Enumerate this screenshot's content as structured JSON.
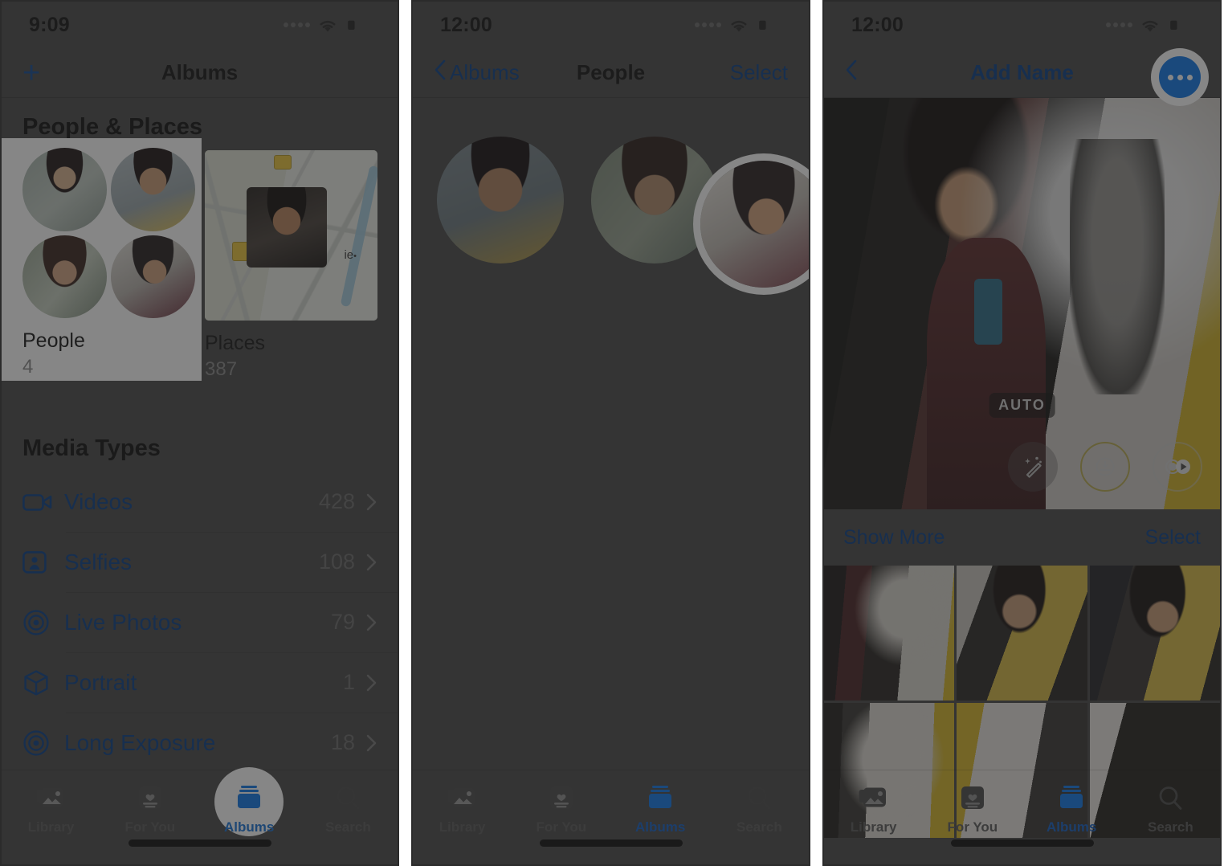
{
  "colors": {
    "ios_blue": "#0b3f86",
    "tab_active": "#1560c4",
    "dim_veil": "#232323",
    "highlight_white": "#ffffff",
    "panel_bg": "#4a4a4a"
  },
  "panels": [
    {
      "id": "albums-screen",
      "status": {
        "time": "9:09",
        "signal": "signal-dots-icon",
        "wifi": "wifi-icon",
        "battery": "battery-low-icon"
      },
      "nav": {
        "left_icon": "plus-icon",
        "title": "Albums",
        "right": ""
      },
      "sections": [
        {
          "heading": "People & Places",
          "cards": [
            {
              "label": "People",
              "count": "4",
              "thumb": "people-faces-grid",
              "highlighted": true
            },
            {
              "label": "Places",
              "count": "387",
              "thumb": "map-thumbnail",
              "highlighted": false
            }
          ]
        },
        {
          "heading": "Media Types",
          "rows": [
            {
              "icon": "video-icon",
              "label": "Videos",
              "count": "428",
              "chevron": "chevron-right-icon"
            },
            {
              "icon": "selfie-icon",
              "label": "Selfies",
              "count": "108",
              "chevron": "chevron-right-icon"
            },
            {
              "icon": "live-photo-icon",
              "label": "Live Photos",
              "count": "79",
              "chevron": "chevron-right-icon"
            },
            {
              "icon": "portrait-cube-icon",
              "label": "Portrait",
              "count": "1",
              "chevron": "chevron-right-icon"
            },
            {
              "icon": "long-exposure-icon",
              "label": "Long Exposure",
              "count": "18",
              "chevron": "chevron-right-icon"
            }
          ]
        }
      ],
      "tabs": [
        {
          "label": "Library",
          "icon": "library-icon",
          "active": false,
          "highlighted": false
        },
        {
          "label": "For You",
          "icon": "for-you-icon",
          "active": false,
          "highlighted": false
        },
        {
          "label": "Albums",
          "icon": "albums-icon",
          "active": true,
          "highlighted": true
        },
        {
          "label": "Search",
          "icon": "search-icon",
          "active": false,
          "highlighted": false
        }
      ]
    },
    {
      "id": "people-screen",
      "status": {
        "time": "12:00",
        "signal": "signal-dots-icon",
        "wifi": "wifi-icon",
        "battery": "battery-low-icon"
      },
      "nav": {
        "back_icon": "chevron-left-icon",
        "back_label": "Albums",
        "title": "People",
        "right": "Select"
      },
      "faces": [
        {
          "name": "person-face-1",
          "highlighted": false
        },
        {
          "name": "person-face-2",
          "highlighted": false
        },
        {
          "name": "person-face-3",
          "highlighted": true
        }
      ],
      "tabs": [
        {
          "label": "Library",
          "icon": "library-icon",
          "active": false,
          "highlighted": false
        },
        {
          "label": "For You",
          "icon": "for-you-icon",
          "active": false,
          "highlighted": false
        },
        {
          "label": "Albums",
          "icon": "albums-icon",
          "active": true,
          "highlighted": false
        },
        {
          "label": "Search",
          "icon": "search-icon",
          "active": false,
          "highlighted": false
        }
      ]
    },
    {
      "id": "add-name-screen",
      "status": {
        "time": "12:00",
        "signal": "signal-dots-icon",
        "wifi": "wifi-icon",
        "battery": "battery-low-icon"
      },
      "nav": {
        "back_icon": "chevron-left-icon",
        "title": "Add Name",
        "right_icon": "more-ellipsis-icon",
        "right_highlighted": true
      },
      "hero": {
        "badge": "AUTO",
        "controls": [
          {
            "name": "auto-enhance-wand-icon"
          },
          {
            "name": "adjust-exposure-icon"
          },
          {
            "name": "live-photo-play-icon"
          }
        ]
      },
      "subbar": {
        "left": "Show More",
        "right": "Select"
      },
      "grid": [
        "photo-thumb-1",
        "photo-thumb-2",
        "photo-thumb-3",
        "photo-thumb-4",
        "photo-thumb-5",
        "photo-thumb-6"
      ],
      "tabs": [
        {
          "label": "Library",
          "icon": "library-icon",
          "active": false,
          "highlighted": false
        },
        {
          "label": "For You",
          "icon": "for-you-icon",
          "active": false,
          "highlighted": false
        },
        {
          "label": "Albums",
          "icon": "albums-icon",
          "active": true,
          "highlighted": false
        },
        {
          "label": "Search",
          "icon": "search-icon",
          "active": false,
          "highlighted": false
        }
      ]
    }
  ]
}
